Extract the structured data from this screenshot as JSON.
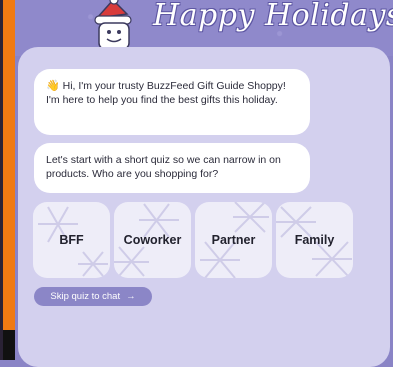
{
  "header": {
    "title": "Happy Holidays"
  },
  "chat": {
    "greeting": "Hi, I'm your trusty BuzzFeed Gift Guide Shoppy! I'm here to help you find the best gifts this holiday.",
    "prompt": "Let's start with a short quiz so we can narrow in on products. Who are you shopping for?"
  },
  "options": [
    {
      "label": "BFF"
    },
    {
      "label": "Coworker"
    },
    {
      "label": "Partner"
    },
    {
      "label": "Family"
    }
  ],
  "skip": {
    "label": "Skip quiz to chat",
    "arrow": "→"
  },
  "colors": {
    "brand_purple": "#8b86c7",
    "panel": "#d3d0ee",
    "accent_orange": "#f07a12"
  }
}
